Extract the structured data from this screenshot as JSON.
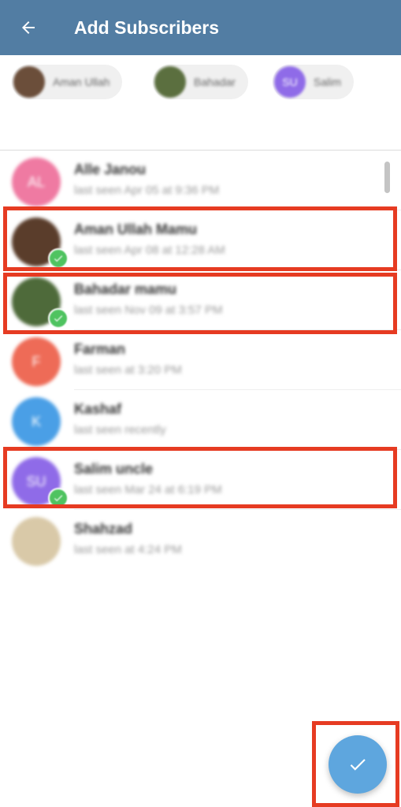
{
  "appbar": {
    "title": "Add Subscribers",
    "background": "#527da3",
    "back_icon": "arrow-left-icon"
  },
  "selected_chips": [
    {
      "label": "Aman Ullah",
      "avatar_color": "#6b4e3a",
      "initials": ""
    },
    {
      "label": "Bahadar",
      "avatar_color": "#5b6f3f",
      "initials": ""
    },
    {
      "label": "Salim",
      "avatar_color": "#8f6be8",
      "initials": "SU"
    }
  ],
  "contacts": [
    {
      "name": "Alle Janou",
      "status": "last seen Apr 05 at 9:36 PM",
      "initials": "AL",
      "avatar_color": "#ef7aa2",
      "selected": false
    },
    {
      "name": "Aman Ullah Mamu",
      "status": "last seen Apr 08 at 12:28 AM",
      "initials": "",
      "avatar_color": "#5a3d2b",
      "selected": true
    },
    {
      "name": "Bahadar mamu",
      "status": "last seen Nov 09 at 3:57 PM",
      "initials": "",
      "avatar_color": "#4e6a3a",
      "selected": true
    },
    {
      "name": "Farman",
      "status": "last seen at 3:20 PM",
      "initials": "F",
      "avatar_color": "#ee6b57",
      "selected": false
    },
    {
      "name": "Kashaf",
      "status": "last seen recently",
      "initials": "K",
      "avatar_color": "#4a9fe6",
      "selected": false
    },
    {
      "name": "Salim uncle",
      "status": "last seen Mar 24 at 6:19 PM",
      "initials": "SU",
      "avatar_color": "#8f6be8",
      "selected": true
    },
    {
      "name": "Shahzad",
      "status": "last seen at 4:24 PM",
      "initials": "",
      "avatar_color": "#d9c9a8",
      "selected": false
    }
  ],
  "check_badge_color": "#4fc360",
  "highlight_color": "#e63b22",
  "fab": {
    "icon": "checkmark-icon",
    "color": "#5ea6de"
  }
}
